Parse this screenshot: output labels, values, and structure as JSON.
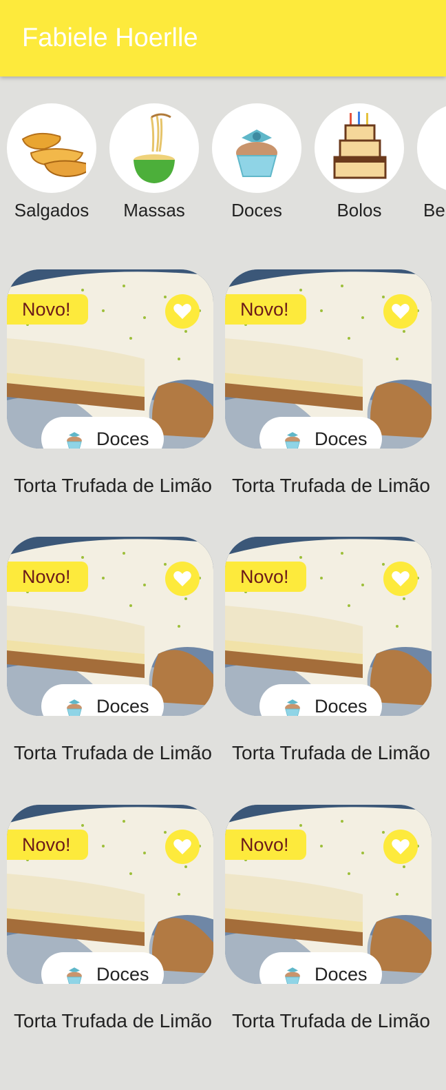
{
  "appbar": {
    "title": "Fabiele Hoerlle",
    "color": "#fdea3c"
  },
  "categories": [
    {
      "label": "Salgados",
      "icon": "potato-wedges-icon"
    },
    {
      "label": "Massas",
      "icon": "noodle-bowl-icon"
    },
    {
      "label": "Doces",
      "icon": "cupcake-icon"
    },
    {
      "label": "Bolos",
      "icon": "birthday-cake-icon"
    },
    {
      "label": "Be",
      "icon": "drink-icon"
    }
  ],
  "recipes": [
    {
      "badge": "Novo!",
      "category": "Doces",
      "title": "Torta Trufada de Limão",
      "favorite_icon": "heart-icon"
    },
    {
      "badge": "Novo!",
      "category": "Doces",
      "title": "Torta Trufada de Limão",
      "favorite_icon": "heart-icon"
    },
    {
      "badge": "Novo!",
      "category": "Doces",
      "title": "Torta Trufada de Limão",
      "favorite_icon": "heart-icon"
    },
    {
      "badge": "Novo!",
      "category": "Doces",
      "title": "Torta Trufada de Limão",
      "favorite_icon": "heart-icon"
    },
    {
      "badge": "Novo!",
      "category": "Doces",
      "title": "Torta Trufada de Limão",
      "favorite_icon": "heart-icon"
    },
    {
      "badge": "Novo!",
      "category": "Doces",
      "title": "Torta Trufada de Limão",
      "favorite_icon": "heart-icon"
    }
  ]
}
